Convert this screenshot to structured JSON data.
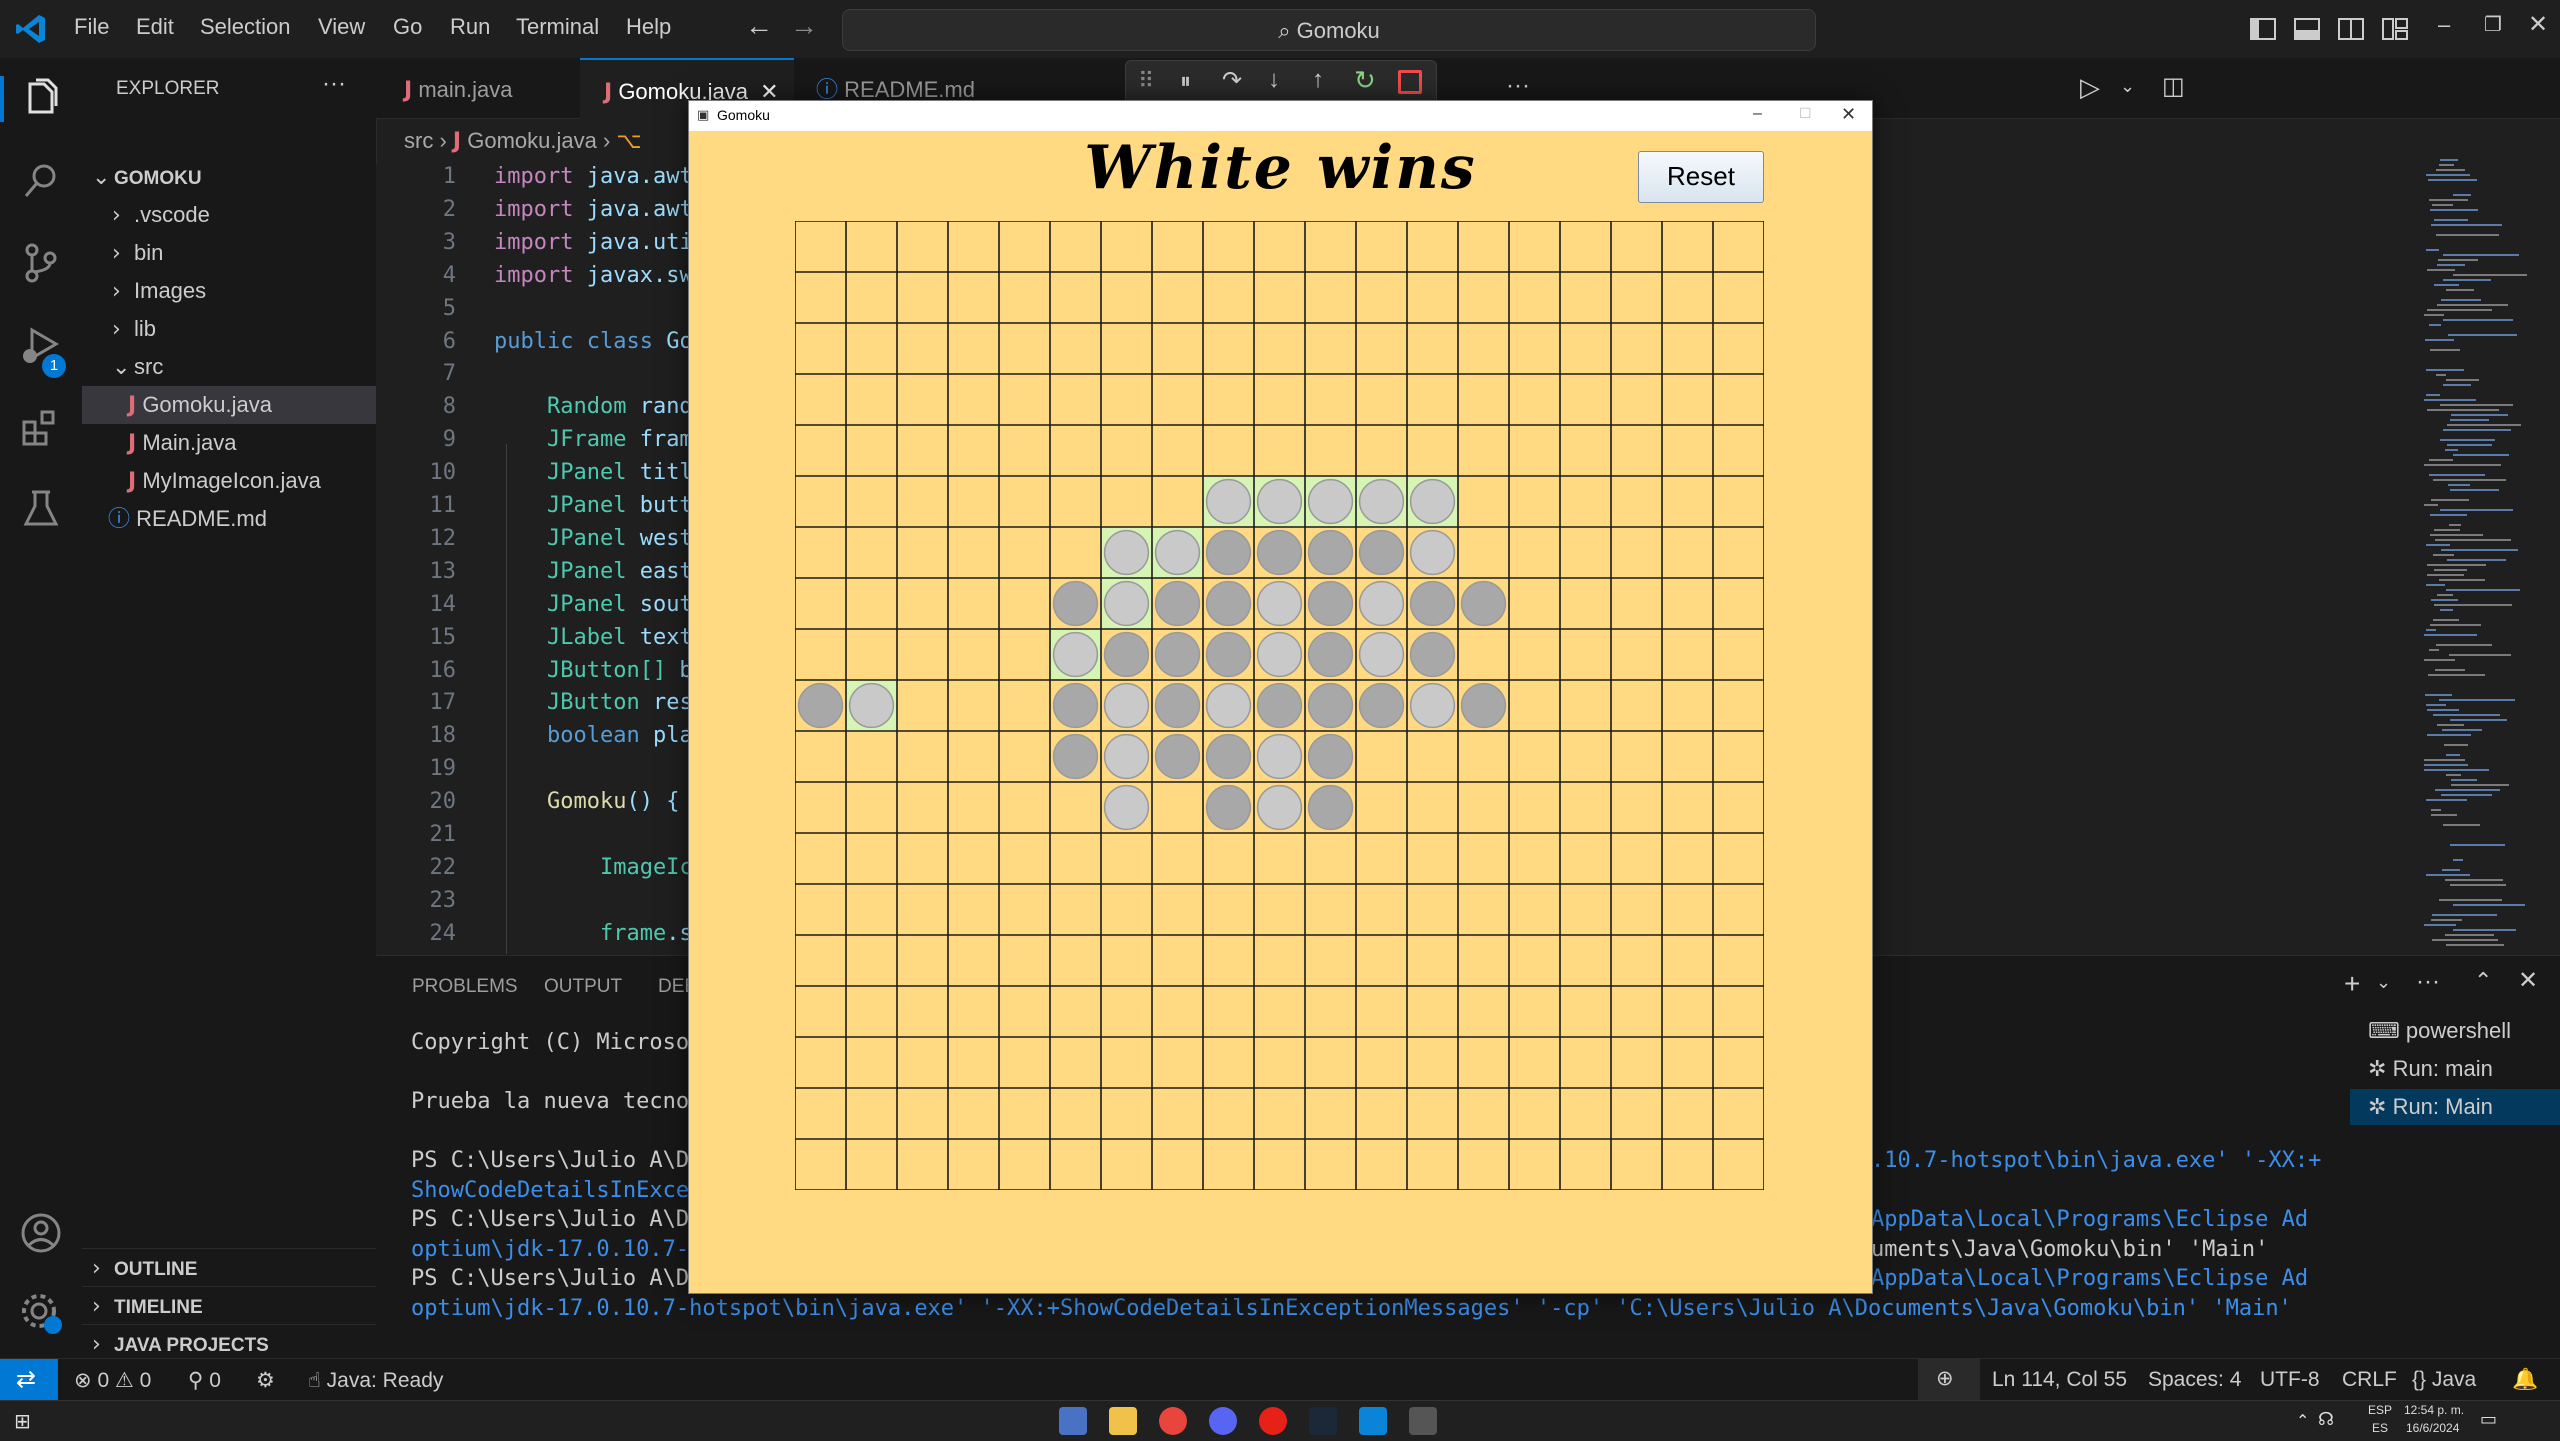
{
  "menu": [
    "File",
    "Edit",
    "Selection",
    "View",
    "Go",
    "Run",
    "Terminal",
    "Help"
  ],
  "command_center": "Gomoku",
  "explorer": {
    "title": "EXPLORER",
    "root": "GOMOKU",
    "items": [
      ".vscode",
      "bin",
      "Images",
      "lib",
      "src",
      "Gomoku.java",
      "Main.java",
      "MyImageIcon.java",
      "README.md"
    ],
    "sections": [
      "OUTLINE",
      "TIMELINE",
      "JAVA PROJECTS"
    ],
    "debug_badge": "1"
  },
  "tabs": [
    "main.java",
    "Gomoku.java",
    "README.md"
  ],
  "breadcrumb": [
    "src",
    "Gomoku.java"
  ],
  "editor": {
    "line_numbers": [
      "1",
      "2",
      "3",
      "4",
      "5",
      "6",
      "7",
      "8",
      "9",
      "10",
      "11",
      "12",
      "13",
      "14",
      "15",
      "16",
      "17",
      "18",
      "19",
      "20",
      "21",
      "22",
      "23",
      "24"
    ],
    "lines": [
      {
        "a": "import",
        "b": " java.awt"
      },
      {
        "a": "import",
        "b": " java.awt"
      },
      {
        "a": "import",
        "b": " java.uti"
      },
      {
        "a": "import",
        "b": " javax.sw"
      },
      {
        "a": "",
        "b": ""
      },
      {
        "a": "public class",
        "b": " Go"
      },
      {
        "a": "",
        "b": ""
      },
      {
        "a": "    Random",
        "b": " rand"
      },
      {
        "a": "    JFrame",
        "b": " fram"
      },
      {
        "a": "    JPanel",
        "b": " titl"
      },
      {
        "a": "    JPanel",
        "b": " butt"
      },
      {
        "a": "    JPanel",
        "b": " west"
      },
      {
        "a": "    JPanel",
        "b": " east"
      },
      {
        "a": "    JPanel",
        "b": " sout"
      },
      {
        "a": "    JLabel",
        "b": " text"
      },
      {
        "a": "    JButton[]",
        "b": " b"
      },
      {
        "a": "    JButton",
        "b": " res"
      },
      {
        "a": "    boolean",
        "b": " pla"
      },
      {
        "a": "",
        "b": ""
      },
      {
        "a": "    Gomoku",
        "b": "() {"
      },
      {
        "a": "",
        "b": ""
      },
      {
        "a": "        ImageIc",
        "b": ""
      },
      {
        "a": "",
        "b": ""
      },
      {
        "a": "        frame",
        "b": ".s"
      }
    ]
  },
  "panel": {
    "tabs": [
      "PROBLEMS",
      "OUTPUT",
      "DEB"
    ],
    "terminal_left": [
      "Copyright (C) Microso",
      "",
      "Prueba la nueva tecno",
      "",
      "PS C:\\Users\\Julio A\\De",
      "ShowCodeDetailsInExcep",
      "PS C:\\Users\\Julio A\\De",
      "optium\\jdk-17.0.10.7-",
      "PS C:\\Users\\Julio A\\De",
      "optium\\jdk-17.0.10.7-hotspot\\bin\\java.exe' '-XX:+ShowCodeDetailsInExceptionMessages' '-cp' 'C:\\Users\\Julio A\\Documents\\Java\\Gomoku\\bin' 'Main'"
    ],
    "terminal_right": [
      ".10.7-hotspot\\bin\\java.exe' '-XX:+",
      "",
      "AppData\\Local\\Programs\\Eclipse Ad",
      "uments\\Java\\Gomoku\\bin' 'Main'",
      "AppData\\Local\\Programs\\Eclipse Ad"
    ],
    "terminals": [
      "powershell",
      "Run: main",
      "Run: Main"
    ]
  },
  "status": {
    "errors": "0",
    "warnings": "0",
    "ports": "0",
    "java": "Java: Ready",
    "position": "Ln 114, Col 55",
    "spaces": "Spaces: 4",
    "encoding": "UTF-8",
    "eol": "CRLF",
    "language": "Java"
  },
  "taskbar": {
    "lang1": "ESP",
    "lang2": "ES",
    "time": "12:54 p. m.",
    "date": "16/6/2024"
  },
  "gomoku": {
    "window_title": "Gomoku",
    "heading": "White wins",
    "reset_label": "Reset",
    "board_size": 19,
    "board_color": "#ffda83",
    "stone_color": "#c9c9c9",
    "stone_dark_color": "#a8a8a8",
    "highlight_color": "#d6f5b5",
    "light_stones": [
      [
        5,
        8
      ],
      [
        5,
        9
      ],
      [
        5,
        10
      ],
      [
        5,
        11
      ],
      [
        5,
        12
      ],
      [
        6,
        6
      ],
      [
        6,
        7
      ],
      [
        6,
        12
      ],
      [
        7,
        6
      ],
      [
        7,
        9
      ],
      [
        7,
        11
      ],
      [
        8,
        5
      ],
      [
        8,
        9
      ],
      [
        8,
        11
      ],
      [
        9,
        1
      ],
      [
        9,
        6
      ],
      [
        9,
        8
      ],
      [
        9,
        12
      ],
      [
        10,
        6
      ],
      [
        10,
        9
      ],
      [
        11,
        6
      ],
      [
        11,
        9
      ]
    ],
    "dark_stones": [
      [
        6,
        8
      ],
      [
        6,
        9
      ],
      [
        6,
        10
      ],
      [
        6,
        11
      ],
      [
        7,
        5
      ],
      [
        7,
        7
      ],
      [
        7,
        8
      ],
      [
        7,
        10
      ],
      [
        7,
        12
      ],
      [
        7,
        13
      ],
      [
        8,
        6
      ],
      [
        8,
        7
      ],
      [
        8,
        8
      ],
      [
        8,
        10
      ],
      [
        8,
        12
      ],
      [
        9,
        0
      ],
      [
        9,
        5
      ],
      [
        9,
        7
      ],
      [
        9,
        9
      ],
      [
        9,
        10
      ],
      [
        9,
        11
      ],
      [
        9,
        13
      ],
      [
        10,
        5
      ],
      [
        10,
        7
      ],
      [
        10,
        8
      ],
      [
        10,
        10
      ],
      [
        11,
        8
      ],
      [
        11,
        10
      ]
    ],
    "highlighted_cells": [
      [
        5,
        8
      ],
      [
        5,
        9
      ],
      [
        5,
        10
      ],
      [
        5,
        11
      ],
      [
        5,
        12
      ],
      [
        6,
        6
      ],
      [
        6,
        7
      ],
      [
        7,
        6
      ],
      [
        8,
        5
      ],
      [
        9,
        1
      ]
    ]
  }
}
